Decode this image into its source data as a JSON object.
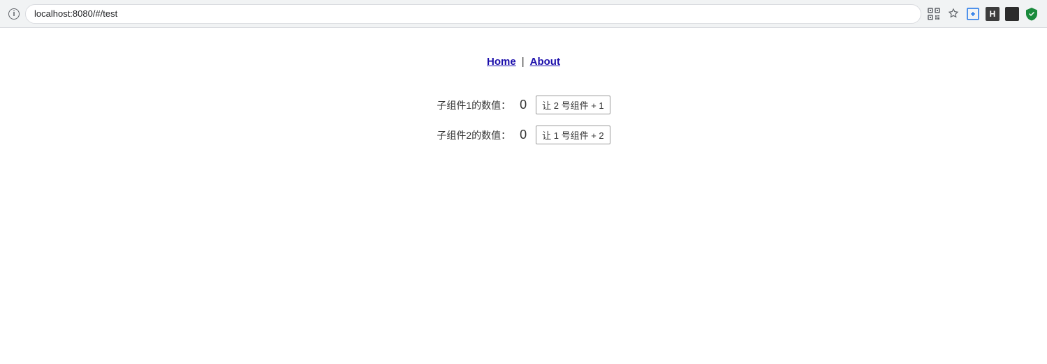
{
  "browser": {
    "url": "localhost:8080/#/test",
    "info_icon": "i"
  },
  "nav": {
    "home_label": "Home",
    "separator": "|",
    "about_label": "About"
  },
  "component1": {
    "label": "子组件1的数值：",
    "value": "0",
    "button_label": "让 2 号组件 + 1"
  },
  "component2": {
    "label": "子组件2的数值：",
    "value": "0",
    "button_label": "让 1 号组件 + 2"
  }
}
